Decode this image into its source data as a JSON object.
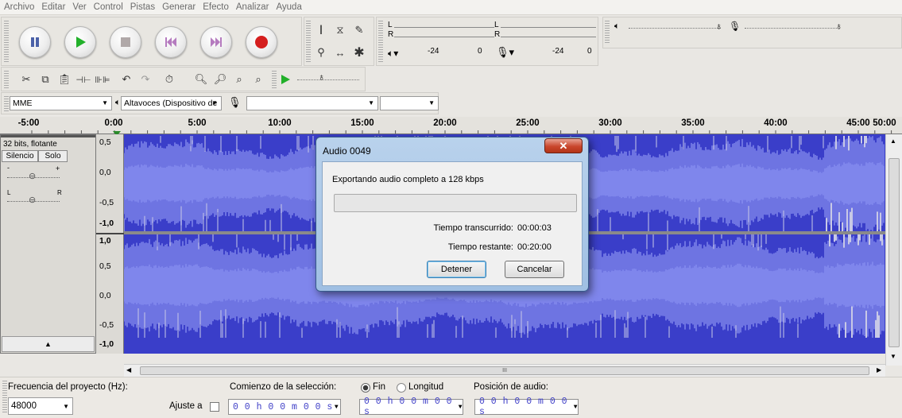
{
  "menu": [
    "Archivo",
    "Editar",
    "Ver",
    "Control",
    "Pistas",
    "Generar",
    "Efecto",
    "Analizar",
    "Ayuda"
  ],
  "meters": {
    "left_channel": "L",
    "right_channel": "R",
    "play_db": "-24",
    "play_zero": "0",
    "rec_db": "-24",
    "rec_zero": "0"
  },
  "device": {
    "host": "MME",
    "output": "Altavoces (Dispositivo de",
    "input": "",
    "channels": ""
  },
  "ruler": [
    "-5:00",
    "0:00",
    "5:00",
    "10:00",
    "15:00",
    "20:00",
    "25:00",
    "30:00",
    "35:00",
    "40:00",
    "45:00",
    "50:00"
  ],
  "track": {
    "format": "32 bits, flotante",
    "mute": "Silencio",
    "solo": "Solo",
    "gain_minus": "-",
    "gain_plus": "+",
    "pan_left": "L",
    "pan_right": "R",
    "collapse": "▲",
    "scale_top": [
      "0,5",
      "0,0",
      "-0,5",
      "-1,0"
    ],
    "scale_bottom": [
      "1,0",
      "0,5",
      "0,0",
      "-0,5",
      "-1,0"
    ]
  },
  "hscroll_label": "III",
  "bottom": {
    "project_rate_label": "Frecuencia del proyecto (Hz):",
    "project_rate": "48000",
    "snap_label": "Ajuste a",
    "selection_label": "Comienzo de la selección:",
    "end_label": "Fin",
    "length_label": "Longitud",
    "audio_pos_label": "Posición de audio:",
    "sel_start": "0 0 h 0 0 m 0 0 s",
    "sel_end": "0 0 h 0 0 m 0 0 s",
    "audio_pos": "0 0 h 0 0 m 0 0 s"
  },
  "dialog": {
    "title": "Audio 0049",
    "message": "Exportando audio completo a 128 kbps",
    "elapsed_label": "Tiempo transcurrido:",
    "elapsed": "00:00:03",
    "remaining_label": "Tiempo restante:",
    "remaining": "00:20:00",
    "stop": "Detener",
    "cancel": "Cancelar",
    "progress_fraction": 0
  },
  "colors": {
    "waveform_bg": "#3a3ec9",
    "waveform": "#6e74e2",
    "waveform_peak": "#c8c9e6",
    "record": "#d51f1f",
    "play": "#22b02a",
    "timecode": "#3d3dc7"
  }
}
